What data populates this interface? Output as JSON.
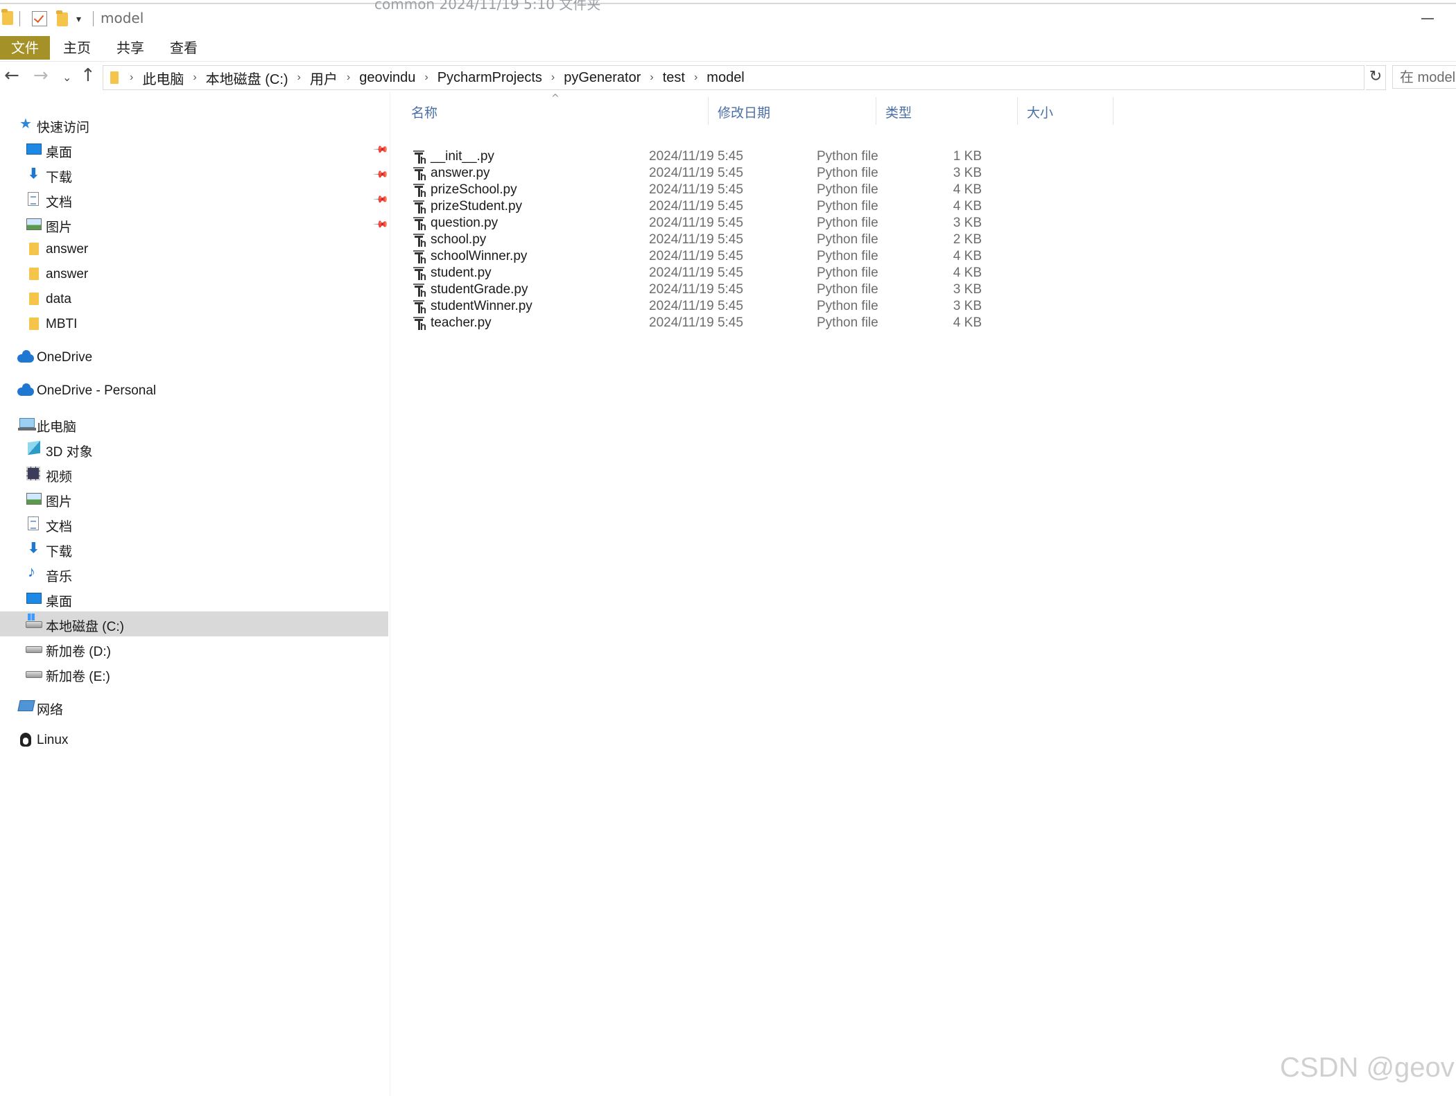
{
  "window": {
    "title": "model",
    "ghost_text": "common   2024/11/19 5:10   文件夹"
  },
  "ribbon": {
    "tabs": [
      "文件",
      "主页",
      "共享",
      "查看"
    ]
  },
  "address": {
    "crumbs": [
      "此电脑",
      "本地磁盘 (C:)",
      "用户",
      "geovindu",
      "PycharmProjects",
      "pyGenerator",
      "test",
      "model"
    ],
    "search_placeholder": "在 model"
  },
  "sidebar": {
    "quick_access": "快速访问",
    "quick_items": [
      {
        "label": "桌面",
        "icon": "desktop-icon"
      },
      {
        "label": "下载",
        "icon": "download-icon"
      },
      {
        "label": "文档",
        "icon": "documents-icon"
      },
      {
        "label": "图片",
        "icon": "pictures-icon"
      },
      {
        "label": "answer",
        "icon": "folder-icon"
      },
      {
        "label": "answer",
        "icon": "folder-icon"
      },
      {
        "label": "data",
        "icon": "folder-icon"
      },
      {
        "label": "MBTI",
        "icon": "folder-icon"
      }
    ],
    "onedrive": "OneDrive",
    "onedrive_personal": "OneDrive - Personal",
    "this_pc": "此电脑",
    "pc_items": [
      {
        "label": "3D 对象",
        "icon": "3d-objects-icon"
      },
      {
        "label": "视频",
        "icon": "video-icon"
      },
      {
        "label": "图片",
        "icon": "pictures-icon"
      },
      {
        "label": "文档",
        "icon": "documents-icon"
      },
      {
        "label": "下载",
        "icon": "download-icon"
      },
      {
        "label": "音乐",
        "icon": "music-icon"
      },
      {
        "label": "桌面",
        "icon": "desktop-icon"
      },
      {
        "label": "本地磁盘 (C:)",
        "icon": "drive-c-icon",
        "selected": true
      },
      {
        "label": "新加卷 (D:)",
        "icon": "drive-icon"
      },
      {
        "label": "新加卷 (E:)",
        "icon": "drive-icon"
      }
    ],
    "network": "网络",
    "linux": "Linux"
  },
  "columns": {
    "name": "名称",
    "date": "修改日期",
    "type": "类型",
    "size": "大小"
  },
  "files": [
    {
      "name": "__init__.py",
      "date": "2024/11/19 5:45",
      "type": "Python file",
      "size": "1 KB"
    },
    {
      "name": "answer.py",
      "date": "2024/11/19 5:45",
      "type": "Python file",
      "size": "3 KB"
    },
    {
      "name": "prizeSchool.py",
      "date": "2024/11/19 5:45",
      "type": "Python file",
      "size": "4 KB"
    },
    {
      "name": "prizeStudent.py",
      "date": "2024/11/19 5:45",
      "type": "Python file",
      "size": "4 KB"
    },
    {
      "name": "question.py",
      "date": "2024/11/19 5:45",
      "type": "Python file",
      "size": "3 KB"
    },
    {
      "name": "school.py",
      "date": "2024/11/19 5:45",
      "type": "Python file",
      "size": "2 KB"
    },
    {
      "name": "schoolWinner.py",
      "date": "2024/11/19 5:45",
      "type": "Python file",
      "size": "4 KB"
    },
    {
      "name": "student.py",
      "date": "2024/11/19 5:45",
      "type": "Python file",
      "size": "4 KB"
    },
    {
      "name": "studentGrade.py",
      "date": "2024/11/19 5:45",
      "type": "Python file",
      "size": "3 KB"
    },
    {
      "name": "studentWinner.py",
      "date": "2024/11/19 5:45",
      "type": "Python file",
      "size": "3 KB"
    },
    {
      "name": "teacher.py",
      "date": "2024/11/19 5:45",
      "type": "Python file",
      "size": "4 KB"
    }
  ],
  "watermark": "CSDN @geovi",
  "colors": {
    "file_tab": "#a49228",
    "header_text": "#4a6fa5",
    "selected_bg": "#d9d9d9",
    "accent_blue": "#1e78d2"
  }
}
